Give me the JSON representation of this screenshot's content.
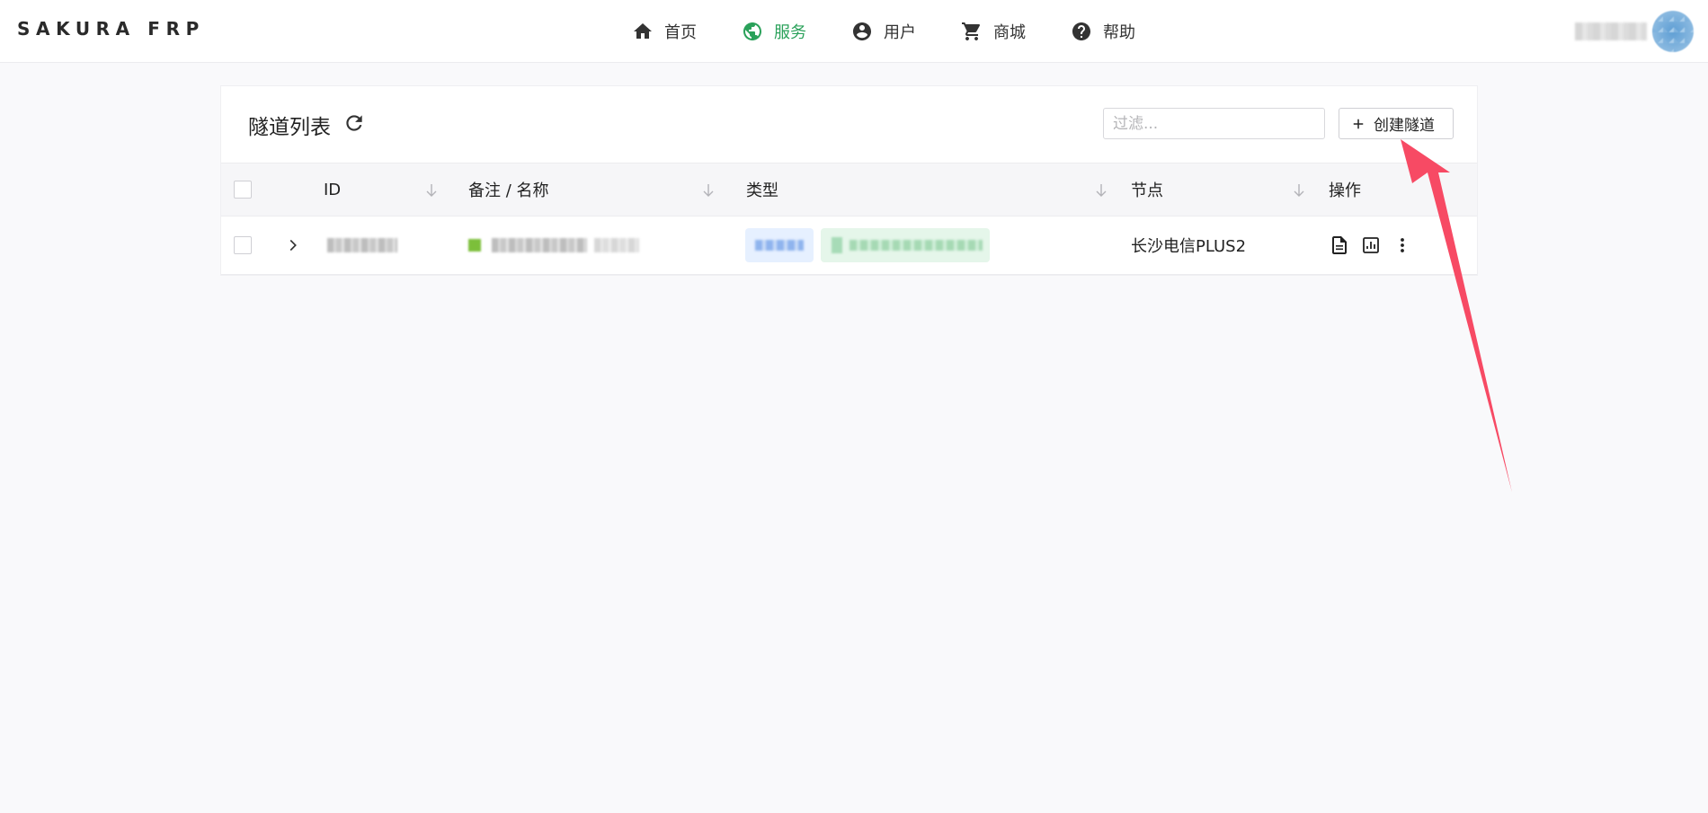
{
  "app": {
    "brand": "SAKURA FRP"
  },
  "nav": {
    "items": [
      {
        "label": "首页",
        "icon": "home-icon",
        "active": false
      },
      {
        "label": "服务",
        "icon": "globe-icon",
        "active": true
      },
      {
        "label": "用户",
        "icon": "account-circle-icon",
        "active": false
      },
      {
        "label": "商城",
        "icon": "cart-icon",
        "active": false
      },
      {
        "label": "帮助",
        "icon": "help-circle-icon",
        "active": false
      }
    ]
  },
  "user": {
    "avatar_icon": "avatar"
  },
  "tunnels": {
    "title": "隧道列表",
    "filter_placeholder": "过滤...",
    "create_label": "创建隧道",
    "columns": {
      "id": "ID",
      "name": "备注 / 名称",
      "type": "类型",
      "node": "节点",
      "actions": "操作"
    },
    "rows": [
      {
        "node": "长沙电信PLUS2"
      }
    ]
  },
  "colors": {
    "accent_green": "#2aa15a",
    "tag_blue_bg": "#e6f0ff",
    "tag_green_bg": "#e5f6ea",
    "arrow": "#f74a64"
  }
}
